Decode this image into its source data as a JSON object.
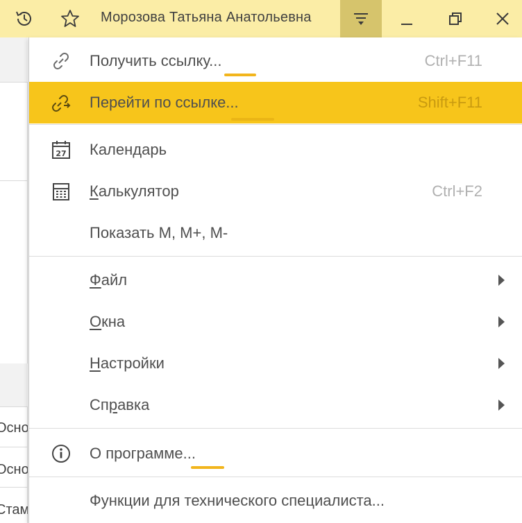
{
  "titlebar": {
    "user_name": "Морозова Татьяна Анатольевна",
    "icons": [
      "history-icon",
      "star-icon",
      "menu-icon",
      "minimize-icon",
      "maximize-icon",
      "close-icon"
    ]
  },
  "background": {
    "row1": "Осно",
    "row2": "Осно",
    "row3": "Стам"
  },
  "menu": {
    "get_link": {
      "label": "Получить ссылку...",
      "shortcut": "Ctrl+F11"
    },
    "go_link": {
      "label": "Перейти по ссылке...",
      "shortcut": "Shift+F11"
    },
    "calendar": {
      "label": "Календарь",
      "icon_text": "27"
    },
    "calculator": {
      "label_u": "К",
      "label_rest": "алькулятор",
      "shortcut": "Ctrl+F2"
    },
    "show_m": {
      "label": "Показать M, M+, M-"
    },
    "file": {
      "label_u": "Ф",
      "label_rest": "айл"
    },
    "windows": {
      "label_u": "О",
      "label_rest": "кна"
    },
    "settings": {
      "label_u": "Н",
      "label_rest": "астройки"
    },
    "help": {
      "label_pre": "Сп",
      "label_u": "р",
      "label_rest": "авка"
    },
    "about": {
      "label": "О программе..."
    },
    "tech": {
      "label": "Функции для технического специалиста..."
    }
  },
  "colors": {
    "titlebar_bg": "#fbeda6",
    "menu_button_bg": "#d6c46c",
    "highlight": "#f7c51b",
    "underline_mark": "#f2b51c"
  }
}
